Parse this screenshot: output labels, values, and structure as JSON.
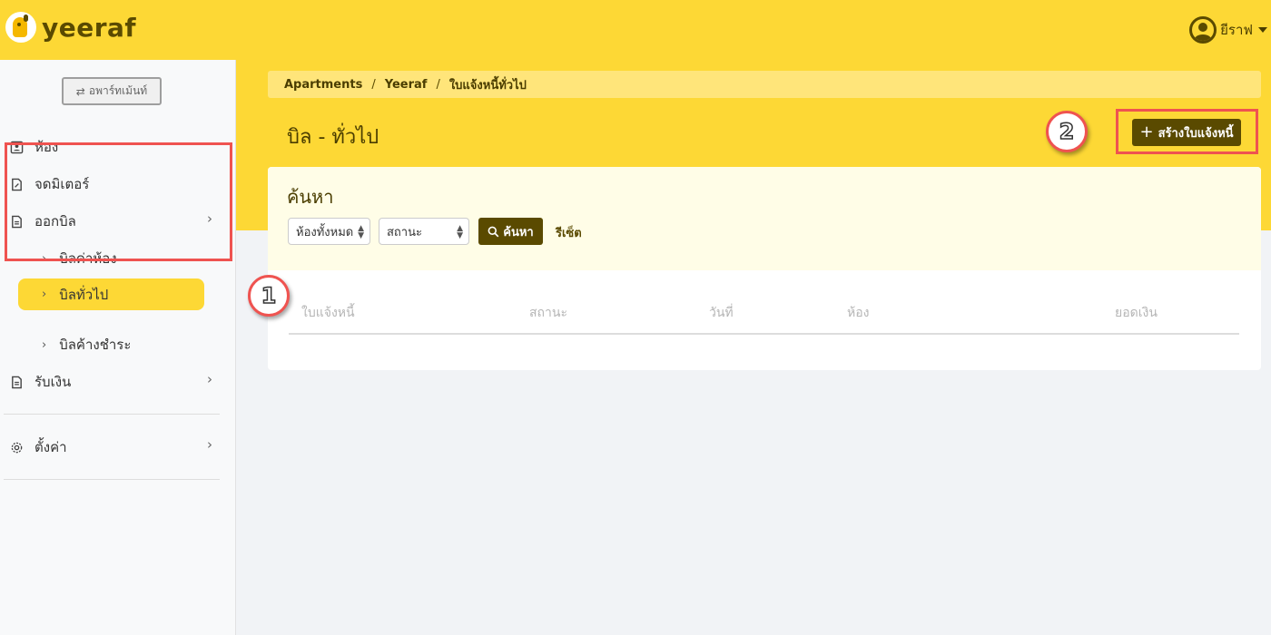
{
  "header": {
    "logo_text": "yeeraf",
    "user_name": "ยีราฟ"
  },
  "sidebar": {
    "apartment_button": "อพาร์ทเม้นท์",
    "items": [
      {
        "label": "ห้อง"
      },
      {
        "label": "จดมิเตอร์"
      },
      {
        "label": "ออกบิล"
      },
      {
        "label": "รับเงิน"
      },
      {
        "label": "ตั้งค่า"
      }
    ],
    "billing_sub": [
      {
        "label": "บิลค่าห้อง"
      },
      {
        "label": "บิลทั่วไป"
      },
      {
        "label": "บิลค้างชำระ"
      }
    ]
  },
  "breadcrumb": [
    "Apartments",
    "Yeeraf",
    "ใบแจ้งหนี้ทั่วไป"
  ],
  "page": {
    "title": "บิล - ทั่วไป",
    "create_button": "สร้างใบแจ้งหนี้"
  },
  "search": {
    "title": "ค้นหา",
    "room_select": "ห้องทั้งหมด",
    "status_select": "สถานะ",
    "search_button": "ค้นหา",
    "reset_link": "รีเซ็ต"
  },
  "table": {
    "columns": [
      "ใบแจ้งหนี้",
      "สถานะ",
      "วันที่",
      "ห้อง",
      "ยอดเงิน"
    ]
  },
  "annotations": {
    "marker1": "1",
    "marker2": "2"
  },
  "colors": {
    "brand_yellow": "#fdd835",
    "brand_dark": "#5a4a00",
    "annotation_red": "#ef5350"
  }
}
